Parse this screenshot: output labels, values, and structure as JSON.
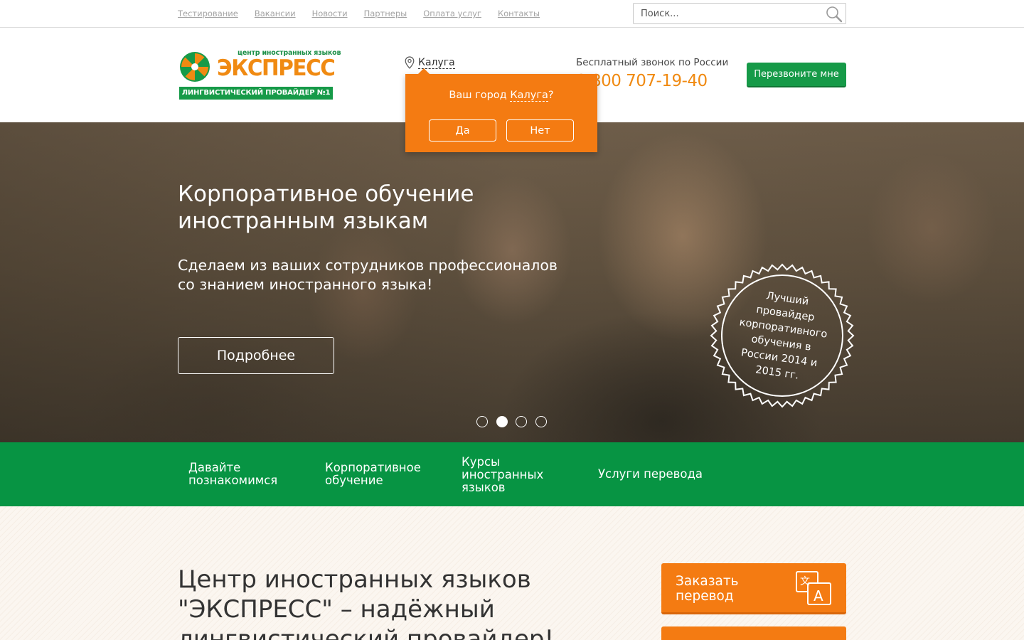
{
  "topnav": {
    "links": [
      "Тестирование",
      "Вакансии",
      "Новости",
      "Партнеры",
      "Оплата услуг",
      "Контакты"
    ],
    "search_placeholder": "Поиск..."
  },
  "logo": {
    "small": "центр иностранных языков",
    "big": "ЭКСПРЕСС",
    "bar": "ЛИНГВИСТИЧЕСКИЙ ПРОВАЙДЕР №1"
  },
  "header": {
    "city": "Калуга",
    "freecall_label": "Бесплатный звонок по России",
    "phone": "8 800 707-19-40",
    "callback_label": "Перезвоните мне"
  },
  "city_popup": {
    "question_prefix": "Ваш город ",
    "city": "Калуга",
    "question_suffix": "?",
    "yes": "Да",
    "no": "Нет"
  },
  "hero": {
    "title_line1": "Корпоративное обучение",
    "title_line2": "иностранным языкам",
    "subtitle": "Сделаем из ваших сотрудников профессионалов со знанием иностранного языка!",
    "more_label": "Подробнее",
    "badge_lines": [
      "Лучший",
      "провайдер",
      "корпоративного",
      "обучения в",
      "России 2014 и",
      "2015 гг."
    ],
    "slide_count": 4,
    "active_slide": 2
  },
  "green_nav": {
    "items": [
      {
        "lines": [
          "Давайте",
          "познакомимся"
        ]
      },
      {
        "lines": [
          "Корпоративное",
          "обучение"
        ]
      },
      {
        "lines": [
          "Курсы",
          "иностранных",
          "языков"
        ]
      },
      {
        "lines": [
          "Услуги перевода"
        ]
      }
    ]
  },
  "bottom": {
    "heading_line1": "Центр иностранных языков",
    "heading_line2": "\"ЭКСПРЕСС\" – надёжный",
    "heading_line3": "лингвистический провайдер!",
    "order_line1": "Заказать",
    "order_line2": "перевод"
  },
  "colors": {
    "brand_green": "#079443",
    "brand_orange": "#f47b12"
  }
}
